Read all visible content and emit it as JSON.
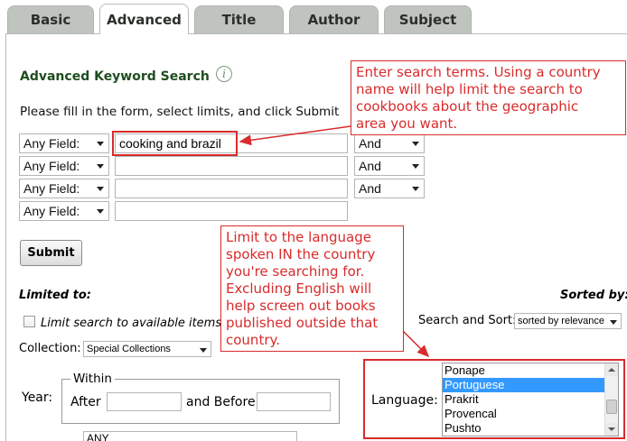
{
  "tabs": [
    {
      "label": "Basic"
    },
    {
      "label": "Advanced"
    },
    {
      "label": "Title"
    },
    {
      "label": "Author"
    },
    {
      "label": "Subject"
    }
  ],
  "active_tab": "Advanced",
  "header": {
    "title": "Advanced Keyword Search",
    "info_glyph": "i",
    "instructions": "Please fill in the form, select limits, and click Submit"
  },
  "rows": [
    {
      "field": "Any Field:",
      "value": "cooking and brazil",
      "operator": "And"
    },
    {
      "field": "Any Field:",
      "value": "",
      "operator": "And"
    },
    {
      "field": "Any Field:",
      "value": "",
      "operator": "And"
    },
    {
      "field": "Any Field:",
      "value": ""
    }
  ],
  "submit_label": "Submit",
  "limits": {
    "limited_to_label": "Limited to:",
    "available_label": "Limit search to available items",
    "collection_label": "Collection:",
    "collection_value": "Special Collections",
    "year_label": "Year:",
    "within_label": "Within",
    "after_label": "After",
    "before_label": "and Before",
    "any_value": "ANY"
  },
  "sort": {
    "sorted_by_label": "Sorted by:",
    "search_sort_label": "Search and Sort:",
    "sort_value": "sorted by relevance"
  },
  "language": {
    "label": "Language:",
    "options": [
      "Ponape",
      "Portuguese",
      "Prakrit",
      "Provencal",
      "Pushto"
    ],
    "selected": "Portuguese"
  },
  "callouts": {
    "search_terms": [
      "Enter search terms. Using a country",
      "name will help limit the search to",
      "cookbooks about the geographic",
      "area you want."
    ],
    "language_tip": [
      "Limit to the language",
      "spoken IN the country",
      "you're searching for.",
      "Excluding English will",
      "help screen out books",
      "published outside that",
      "country."
    ]
  },
  "colors": {
    "annotation_red": "#d92b2b",
    "heading_green": "#1f4d1f",
    "tab_gray": "#bfc4bf",
    "selection_blue": "#3399ff"
  }
}
